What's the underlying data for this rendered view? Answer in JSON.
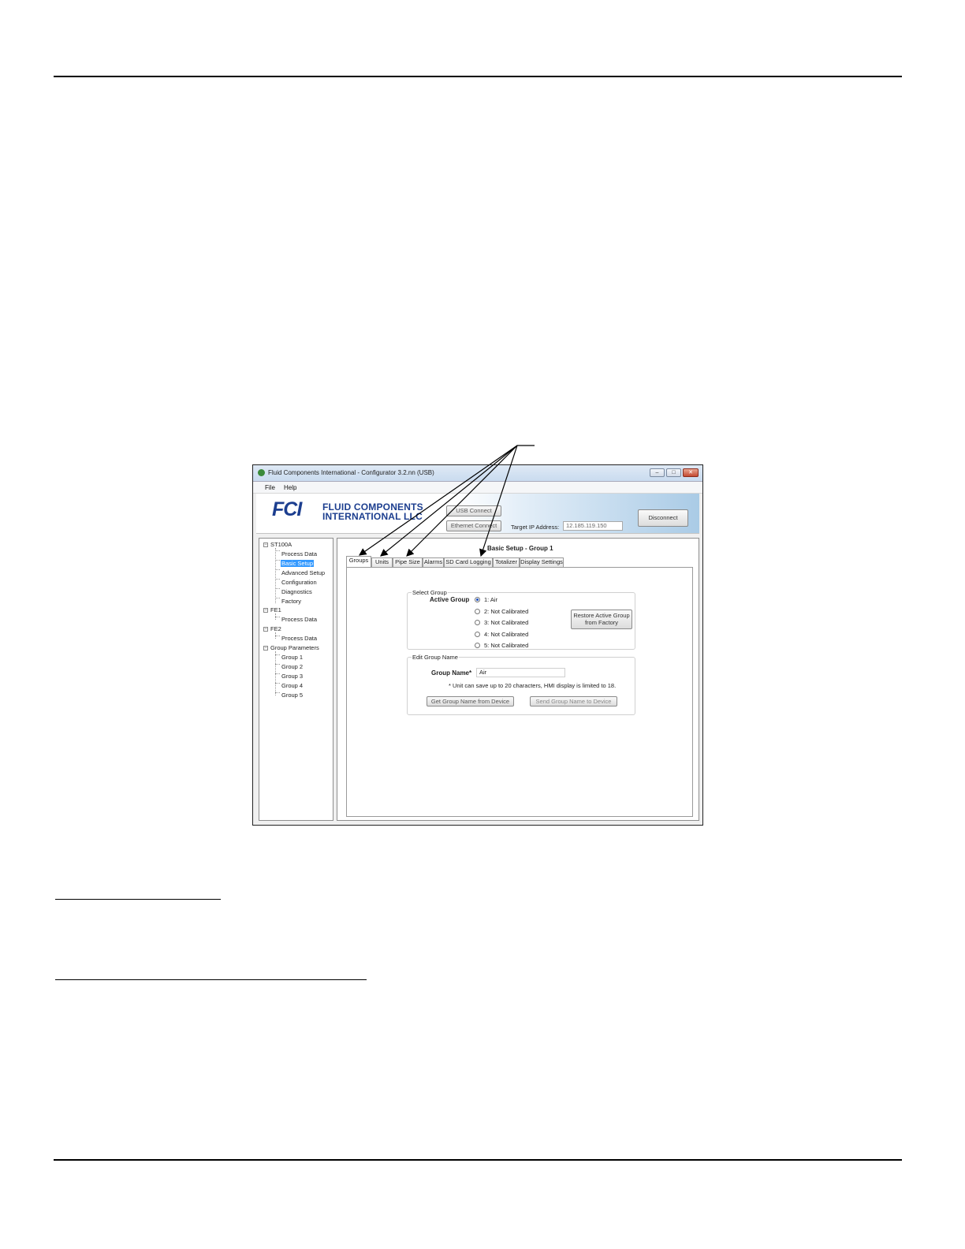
{
  "window": {
    "title": "Fluid Components International - Configurator 3.2.nn (USB)",
    "minimize": "–",
    "maximize": "□",
    "close": "✕"
  },
  "menu": {
    "file": "File",
    "help": "Help"
  },
  "banner": {
    "logo_mark": "FCI",
    "logo_line1": "FLUID COMPONENTS",
    "logo_line2": "INTERNATIONAL LLC",
    "usb_connect": "USB Connect",
    "ethernet_connect": "Ethernet Connect",
    "target_ip_label": "Target IP Address:",
    "target_ip_value": "12.185.119.150",
    "disconnect": "Disconnect"
  },
  "tree": {
    "root": "ST100A",
    "root_children": [
      "Process Data",
      "Basic Setup",
      "Advanced Setup",
      "Configuration",
      "Diagnostics",
      "Factory"
    ],
    "fe1": "FE1",
    "fe1_children": [
      "Process Data"
    ],
    "fe2": "FE2",
    "fe2_children": [
      "Process Data"
    ],
    "group_params": "Group Parameters",
    "group_children": [
      "Group 1",
      "Group 2",
      "Group 3",
      "Group 4",
      "Group 5"
    ],
    "selected": "Basic Setup"
  },
  "main": {
    "heading": "Basic Setup - Group 1",
    "tabs": [
      "Groups",
      "Units",
      "Pipe Size",
      "Alarms",
      "SD Card Logging",
      "Totalizer",
      "Display Settings"
    ],
    "active_tab": "Groups",
    "select_group": {
      "title": "Select Group",
      "active_group_label": "Active Group",
      "options": [
        "1: Air",
        "2: Not Calibrated",
        "3: Not Calibrated",
        "4: Not Calibrated",
        "5: Not Calibrated"
      ],
      "selected_index": 0,
      "restore_line1": "Restore Active Group",
      "restore_line2": "from Factory"
    },
    "edit_group": {
      "title": "Edit Group Name",
      "name_label": "Group Name*",
      "name_value": "Air",
      "note": "* Unit can save up to 20 characters, HMI display is limited to 18.",
      "get_button": "Get Group Name from Device",
      "send_button": "Send Group Name to Device"
    }
  }
}
